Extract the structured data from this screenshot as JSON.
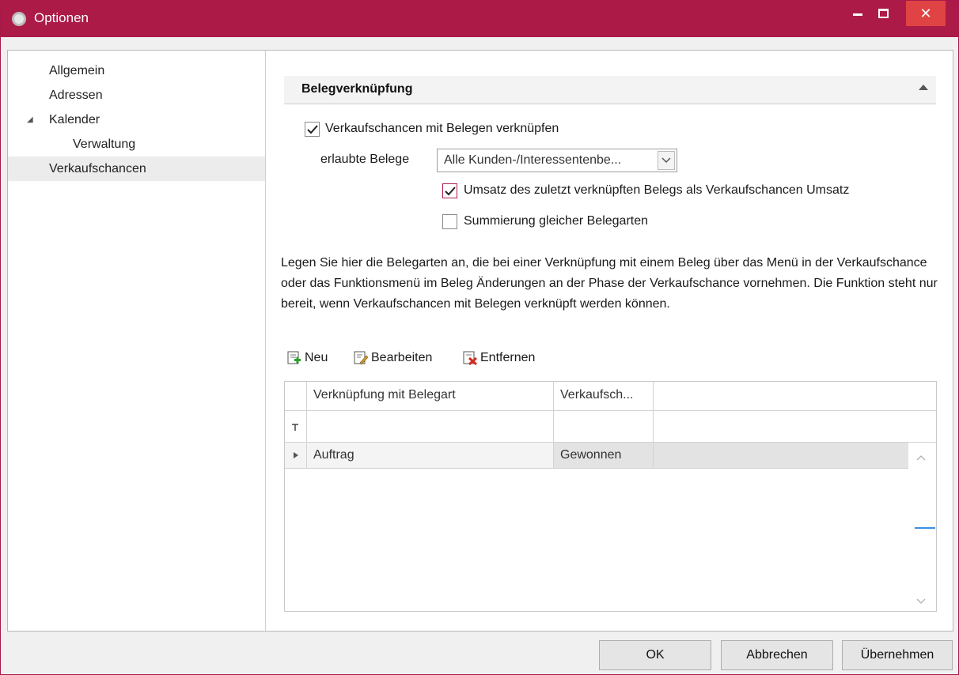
{
  "window": {
    "title": "Optionen",
    "accent_color": "#ac1a48",
    "controls": {
      "minimize": "–",
      "maximize": "□",
      "close": "✕"
    }
  },
  "sidebar": {
    "items": [
      {
        "label": "Allgemein",
        "level": 0
      },
      {
        "label": "Adressen",
        "level": 0
      },
      {
        "label": "Kalender",
        "level": 0,
        "expanded": true
      },
      {
        "label": "Verwaltung",
        "level": 1
      },
      {
        "label": "Verkaufschancen",
        "level": 0,
        "selected": true
      }
    ]
  },
  "section": {
    "title": "Belegverknüpfung"
  },
  "options": {
    "link_checkbox": {
      "label": "Verkaufschancen mit Belegen verknüpfen",
      "checked": true
    },
    "allowed_docs": {
      "label": "erlaubte Belege",
      "value": "Alle  Kunden-/Interessentenbe..."
    },
    "revenue_checkbox": {
      "label": "Umsatz des zuletzt verknüpften Belegs als Verkaufschancen Umsatz",
      "checked": true
    },
    "sum_checkbox": {
      "label": "Summierung gleicher Belegarten",
      "checked": false
    }
  },
  "description": "Legen Sie hier die Belegarten an, die bei einer Verknüpfung mit einem Beleg über das Menü in der Verkaufschance oder das Funktionsmenü im Beleg Änderungen an der Phase der Verkaufschance vornehmen. Die Funktion steht nur bereit, wenn Verkaufschancen mit Belegen verknüpft werden können.",
  "toolbar": {
    "new_label": "Neu",
    "edit_label": "Bearbeiten",
    "remove_label": "Entfernen"
  },
  "grid": {
    "columns": [
      "Verknüpfung mit Belegart",
      "Verkaufsch..."
    ],
    "rows": [
      {
        "belegart": "Auftrag",
        "phase": "Gewonnen"
      }
    ]
  },
  "footer": {
    "ok_label": "OK",
    "cancel_label": "Abbrechen",
    "apply_label": "Übernehmen"
  }
}
